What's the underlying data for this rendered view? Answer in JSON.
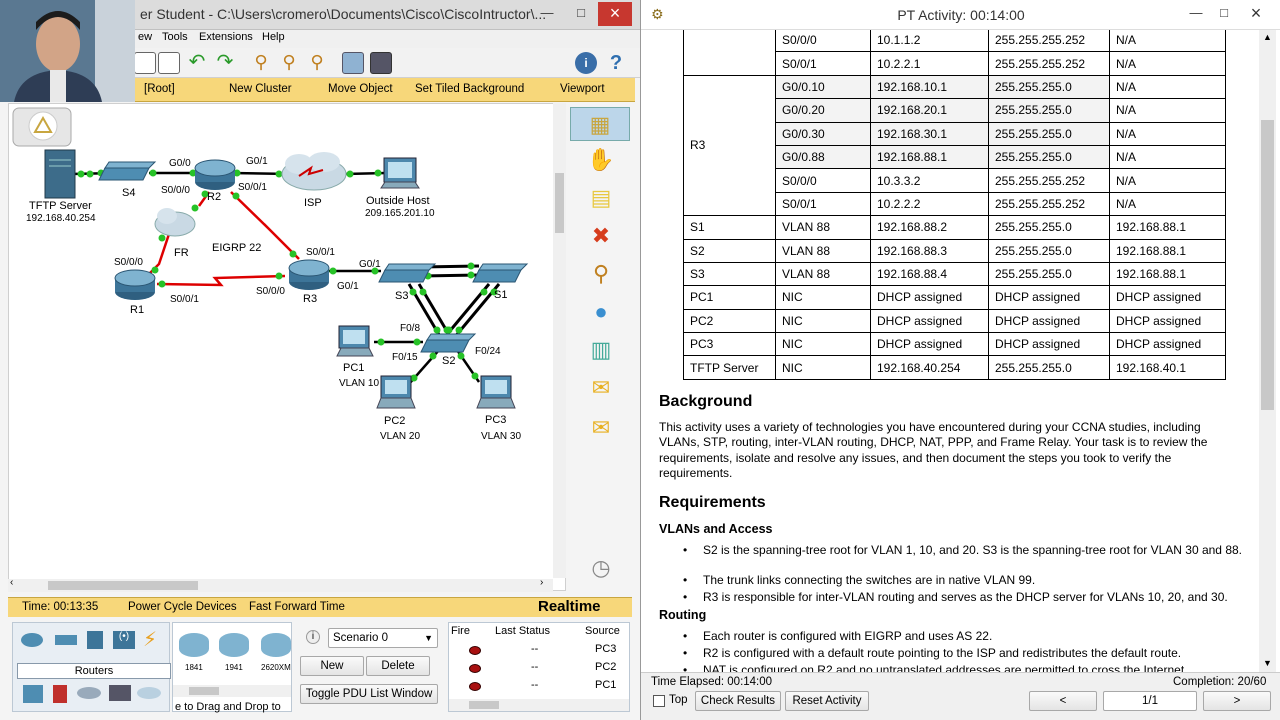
{
  "pt": {
    "title": "er Student - C:\\Users\\cromero\\Documents\\Cisco\\CiscoIntructor\\...",
    "menu": [
      "ew",
      "Tools",
      "Extensions",
      "Help"
    ],
    "nav": [
      "[Root]",
      "New Cluster",
      "Move Object",
      "Set Tiled Background",
      "Viewport"
    ],
    "topology": {
      "labels": {
        "tftp_name": "TFTP Server",
        "tftp_ip": "192.168.40.254",
        "s4": "S4",
        "r2": "R2",
        "isp": "ISP",
        "outside_name": "Outside Host",
        "outside_ip": "209.165.201.10",
        "fr": "FR",
        "eigrp": "EIGRP 22",
        "r1": "R1",
        "r3": "R3",
        "s1": "S1",
        "s2": "S2",
        "s3": "S3",
        "pc1": "PC1",
        "pc1_vlan": "VLAN 10",
        "pc2": "PC2",
        "pc2_vlan": "VLAN 20",
        "pc3": "PC3",
        "pc3_vlan": "VLAN 30"
      },
      "ports": {
        "r2_g00": "G0/0",
        "r2_g01": "G0/1",
        "r2_s000": "S0/0/0",
        "r2_s001": "S0/0/1",
        "r3_s001": "S0/0/1",
        "r3_g01a": "G0/1",
        "r3_g01b": "G0/1",
        "r3_s000": "S0/0/0",
        "r1_s000": "S0/0/0",
        "r1_s001": "S0/0/1",
        "f08": "F0/8",
        "f015": "F0/15",
        "f024": "F0/24"
      }
    },
    "status": {
      "time": "Time: 00:13:35",
      "power": "Power Cycle Devices",
      "ffwd": "Fast Forward Time",
      "mode": "Realtime"
    },
    "devices": {
      "category": "Routers",
      "models": [
        "1841",
        "1941",
        "2620XM"
      ],
      "drag_hint": "e to Drag and Drop to"
    },
    "scenario": {
      "select": "Scenario 0",
      "new": "New",
      "delete": "Delete",
      "toggle": "Toggle PDU List Window"
    },
    "pdu": {
      "headers": [
        "Fire",
        "Last Status",
        "Source"
      ],
      "rows": [
        {
          "status": "--",
          "source": "PC3"
        },
        {
          "status": "--",
          "source": "PC2"
        },
        {
          "status": "--",
          "source": "PC1"
        }
      ]
    }
  },
  "activity": {
    "title": "PT Activity: 00:14:00",
    "table_rows": [
      [
        "",
        "S0/0/0",
        "10.1.1.2",
        "255.255.255.252",
        "N/A"
      ],
      [
        "",
        "S0/0/1",
        "10.2.2.1",
        "255.255.255.252",
        "N/A"
      ],
      [
        "R3",
        "G0/0.10",
        "192.168.10.1",
        "255.255.255.0",
        "N/A"
      ],
      [
        "",
        "G0/0.20",
        "192.168.20.1",
        "255.255.255.0",
        "N/A"
      ],
      [
        "",
        "G0/0.30",
        "192.168.30.1",
        "255.255.255.0",
        "N/A"
      ],
      [
        "",
        "G0/0.88",
        "192.168.88.1",
        "255.255.255.0",
        "N/A"
      ],
      [
        "",
        "S0/0/0",
        "10.3.3.2",
        "255.255.255.252",
        "N/A"
      ],
      [
        "",
        "S0/0/1",
        "10.2.2.2",
        "255.255.255.252",
        "N/A"
      ],
      [
        "S1",
        "VLAN 88",
        "192.168.88.2",
        "255.255.255.0",
        "192.168.88.1"
      ],
      [
        "S2",
        "VLAN 88",
        "192.168.88.3",
        "255.255.255.0",
        "192.168.88.1"
      ],
      [
        "S3",
        "VLAN 88",
        "192.168.88.4",
        "255.255.255.0",
        "192.168.88.1"
      ],
      [
        "PC1",
        "NIC",
        "DHCP assigned",
        "DHCP assigned",
        "DHCP assigned"
      ],
      [
        "PC2",
        "NIC",
        "DHCP assigned",
        "DHCP assigned",
        "DHCP assigned"
      ],
      [
        "PC3",
        "NIC",
        "DHCP assigned",
        "DHCP assigned",
        "DHCP assigned"
      ],
      [
        "TFTP Server",
        "NIC",
        "192.168.40.254",
        "255.255.255.0",
        "192.168.40.1"
      ]
    ],
    "background_heading": "Background",
    "background_text": "This activity uses a variety of technologies you have encountered during your CCNA studies, including VLANs, STP, routing, inter-VLAN routing, DHCP, NAT, PPP, and Frame Relay. Your task is to review the requirements, isolate and resolve any issues, and then document the steps you took to verify the requirements.",
    "requirements_heading": "Requirements",
    "vlans_heading": "VLANs and Access",
    "vlans_bullets": [
      "S2 is the spanning-tree root for VLAN 1, 10, and 20. S3 is the spanning-tree root for VLAN 30 and 88.",
      "The trunk links connecting the switches are in native VLAN 99.",
      "R3 is responsible for inter-VLAN routing and serves as the DHCP server for VLANs 10, 20, and 30."
    ],
    "routing_heading": "Routing",
    "routing_bullets": [
      "Each router is configured with EIGRP and uses AS 22.",
      "R2 is configured with a default route pointing to the ISP and redistributes the default route.",
      "NAT is configured on R2 and no untranslated addresses are permitted to cross the Internet."
    ],
    "footer": {
      "elapsed": "Time Elapsed: 00:14:00",
      "completion": "Completion: 20/60",
      "top": "Top",
      "check": "Check Results",
      "reset": "Reset Activity",
      "prev": "<",
      "page": "1/1",
      "next": ">"
    }
  }
}
